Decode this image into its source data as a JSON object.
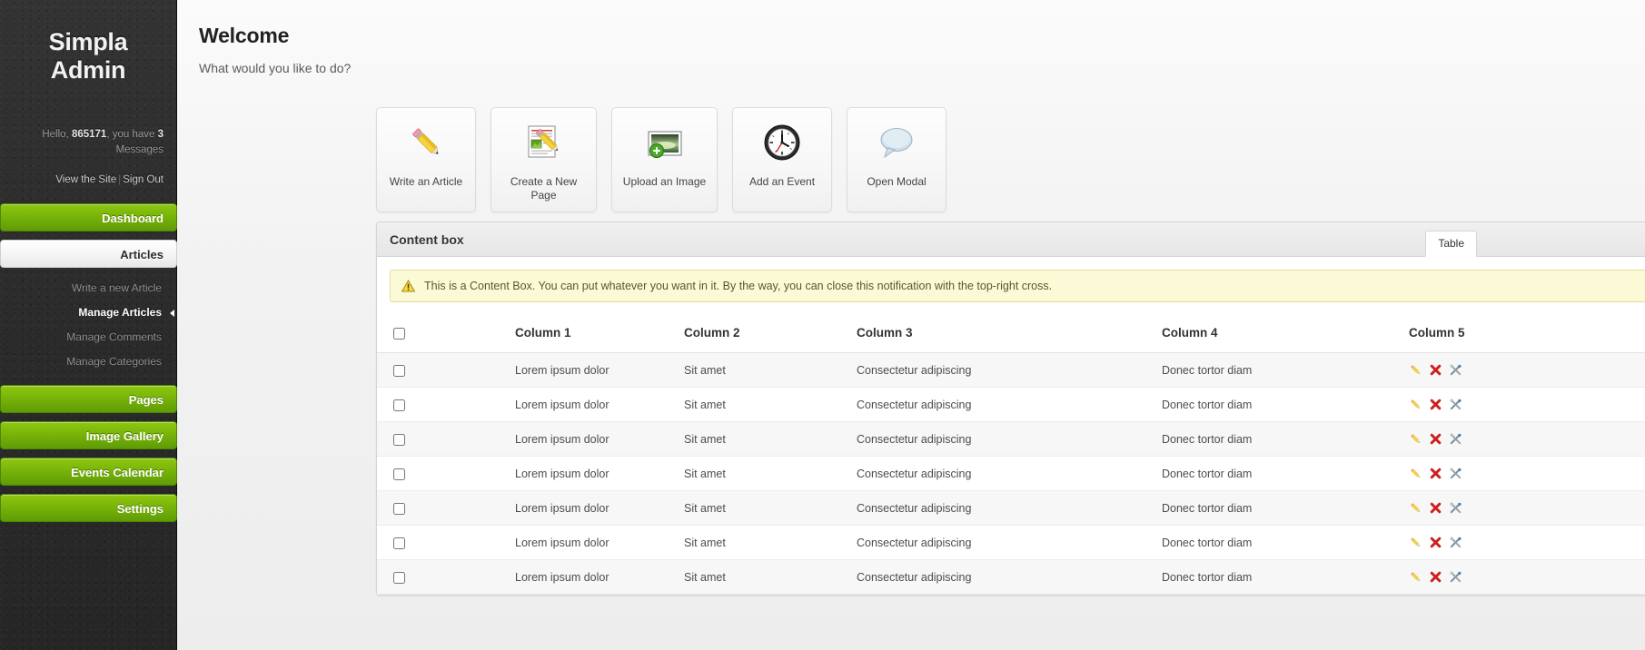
{
  "sidebar": {
    "brand": "Simpla Admin",
    "greeting_prefix": "Hello, ",
    "greeting_user": "865171",
    "greeting_middle": ", you have ",
    "greeting_count": "3",
    "greeting_suffix": " Messages",
    "view_site": "View the Site",
    "separator": "|",
    "sign_out": "Sign Out",
    "nav": [
      {
        "label": "Dashboard",
        "style": "green"
      },
      {
        "label": "Articles",
        "style": "active-white"
      },
      {
        "label": "Pages",
        "style": "green"
      },
      {
        "label": "Image Gallery",
        "style": "green"
      },
      {
        "label": "Events Calendar",
        "style": "green"
      },
      {
        "label": "Settings",
        "style": "green"
      }
    ],
    "subnav": [
      {
        "label": "Write a new Article",
        "current": false
      },
      {
        "label": "Manage Articles",
        "current": true
      },
      {
        "label": "Manage Comments",
        "current": false
      },
      {
        "label": "Manage Categories",
        "current": false
      }
    ]
  },
  "page": {
    "title": "Welcome",
    "subtitle": "What would you like to do?"
  },
  "cards": [
    {
      "label": "Write an Article",
      "icon": "pencil-icon"
    },
    {
      "label": "Create a New Page",
      "icon": "page-edit-icon"
    },
    {
      "label": "Upload an Image",
      "icon": "image-add-icon"
    },
    {
      "label": "Add an Event",
      "icon": "clock-icon"
    },
    {
      "label": "Open Modal",
      "icon": "speech-bubble-icon"
    }
  ],
  "content_box": {
    "title": "Content box",
    "tabs": [
      {
        "label": "Table",
        "active": true
      }
    ],
    "notice": "This is a Content Box. You can put whatever you want in it. By the way, you can close this notification with the top-right cross.",
    "notice_icon": "warning-triangle-icon"
  },
  "table": {
    "headers": [
      "",
      "Column 1",
      "Column 2",
      "Column 3",
      "Column 4",
      "Column 5"
    ],
    "row_actions": [
      "edit-pencil-icon",
      "delete-cross-icon",
      "tools-icon"
    ],
    "rows": [
      {
        "c1": "Lorem ipsum dolor",
        "c2": "Sit amet",
        "c3": "Consectetur adipiscing",
        "c4": "Donec tortor diam"
      },
      {
        "c1": "Lorem ipsum dolor",
        "c2": "Sit amet",
        "c3": "Consectetur adipiscing",
        "c4": "Donec tortor diam"
      },
      {
        "c1": "Lorem ipsum dolor",
        "c2": "Sit amet",
        "c3": "Consectetur adipiscing",
        "c4": "Donec tortor diam"
      },
      {
        "c1": "Lorem ipsum dolor",
        "c2": "Sit amet",
        "c3": "Consectetur adipiscing",
        "c4": "Donec tortor diam"
      },
      {
        "c1": "Lorem ipsum dolor",
        "c2": "Sit amet",
        "c3": "Consectetur adipiscing",
        "c4": "Donec tortor diam"
      },
      {
        "c1": "Lorem ipsum dolor",
        "c2": "Sit amet",
        "c3": "Consectetur adipiscing",
        "c4": "Donec tortor diam"
      },
      {
        "c1": "Lorem ipsum dolor",
        "c2": "Sit amet",
        "c3": "Consectetur adipiscing",
        "c4": "Donec tortor diam"
      }
    ]
  },
  "colors": {
    "accent_green": "#79b40a",
    "link_green": "#629026",
    "sidebar_dark": "#2b2b2b",
    "notice_bg": "#fcfad6"
  }
}
